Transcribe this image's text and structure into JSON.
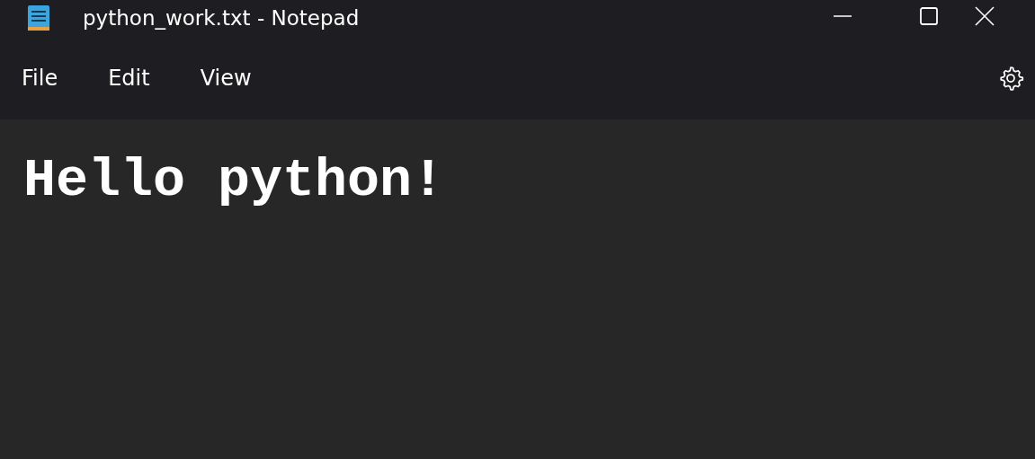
{
  "window": {
    "title": "python_work.txt - Notepad"
  },
  "menu": [
    {
      "label": "File"
    },
    {
      "label": "Edit"
    },
    {
      "label": "View"
    }
  ],
  "editor": {
    "text": "Hello python!"
  }
}
